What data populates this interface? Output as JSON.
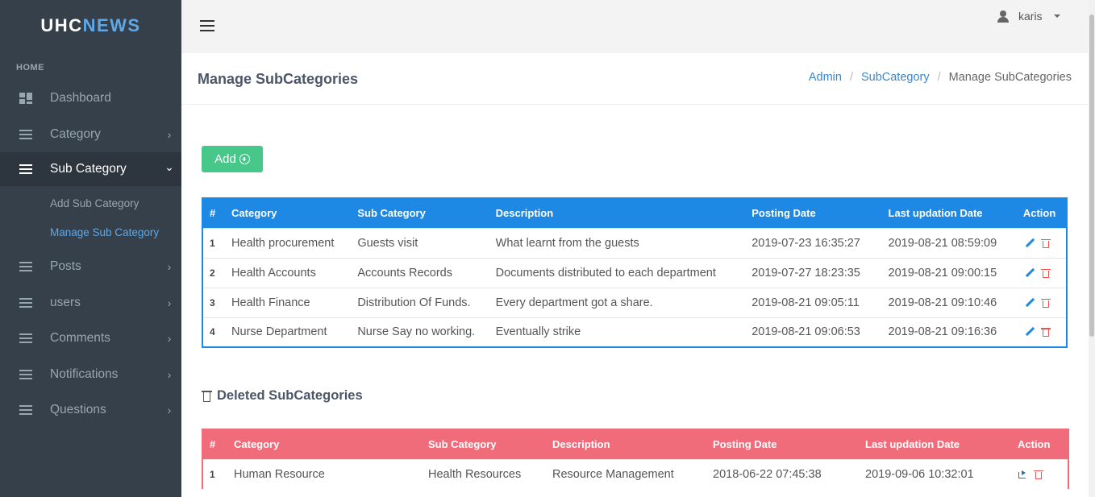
{
  "brand": {
    "part1": "UHC",
    "part2": "NEWS"
  },
  "sidebar": {
    "heading": "HOME",
    "items": [
      {
        "label": "Dashboard",
        "icon": "dashboard-icon"
      },
      {
        "label": "Category",
        "icon": "list-icon",
        "chevron": "›"
      },
      {
        "label": "Sub Category",
        "icon": "list-icon",
        "chevron": "⌄"
      },
      {
        "label": "Posts",
        "icon": "list-icon",
        "chevron": "›"
      },
      {
        "label": "users",
        "icon": "list-icon",
        "chevron": "›"
      },
      {
        "label": "Comments",
        "icon": "list-icon",
        "chevron": "›"
      },
      {
        "label": "Notifications",
        "icon": "list-icon",
        "chevron": "›"
      },
      {
        "label": "Questions",
        "icon": "list-icon",
        "chevron": "›"
      }
    ],
    "subitems": [
      {
        "label": "Add Sub Category"
      },
      {
        "label": "Manage Sub Category"
      }
    ]
  },
  "topbar": {
    "username": "karis"
  },
  "page": {
    "title": "Manage SubCategories",
    "breadcrumb": [
      "Admin",
      "SubCategory",
      "Manage SubCategories"
    ]
  },
  "add_button": {
    "label": "Add"
  },
  "active_table": {
    "columns": [
      "#",
      "Category",
      "Sub Category",
      "Description",
      "Posting Date",
      "Last updation Date",
      "Action"
    ],
    "rows": [
      [
        "1",
        "Health procurement",
        "Guests visit",
        "What learnt from the guests",
        "2019-07-23 16:35:27",
        "2019-08-21 08:59:09"
      ],
      [
        "2",
        "Health Accounts",
        "Accounts Records",
        "Documents distributed to each department",
        "2019-07-27 18:23:35",
        "2019-08-21 09:00:15"
      ],
      [
        "3",
        "Health Finance",
        "Distribution Of Funds.",
        "Every department got a share.",
        "2019-08-21 09:05:11",
        "2019-08-21 09:10:46"
      ],
      [
        "4",
        "Nurse Department",
        "Nurse Say no working.",
        "Eventually strike",
        "2019-08-21 09:06:53",
        "2019-08-21 09:16:36"
      ]
    ]
  },
  "deleted": {
    "heading": "Deleted SubCategories",
    "columns": [
      "#",
      "Category",
      "Sub Category",
      "Description",
      "Posting Date",
      "Last updation Date",
      "Action"
    ],
    "rows": [
      [
        "1",
        "Human Resource",
        "Health Resources",
        "Resource Management",
        "2018-06-22 07:45:38",
        "2019-09-06 10:32:01"
      ]
    ]
  },
  "colors": {
    "sidebar_bg": "#36404a",
    "accent_blue": "#1e88e5",
    "deleted_red": "#f16c7a",
    "add_green": "#47c78a"
  }
}
